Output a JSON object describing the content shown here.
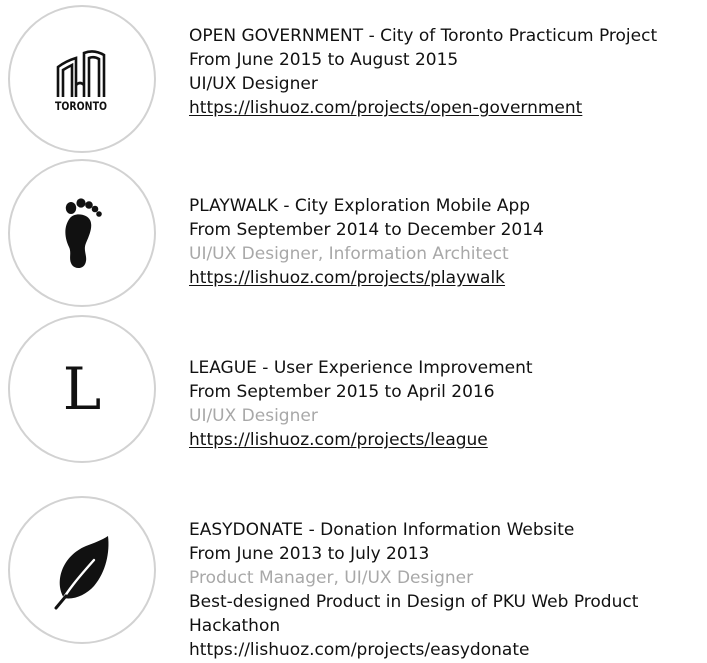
{
  "projects": [
    {
      "logo_icon": "toronto-city-hall-icon",
      "logo_text": "TORONTO",
      "title": "OPEN GOVERNMENT - City of Toronto Practicum Project",
      "dates": "From June 2015 to August 2015",
      "role": "UI/UX Designer",
      "url": "https://lishuoz.com/projects/open-government"
    },
    {
      "logo_icon": "footprint-icon",
      "title": "PLAYWALK - City Exploration Mobile App",
      "dates": "From September 2014 to December 2014",
      "role": "UI/UX Designer, Information Architect",
      "url": "https://lishuoz.com/projects/playwalk"
    },
    {
      "logo_icon": "letter-l-icon",
      "logo_letter": "L",
      "title": "LEAGUE - User Experience Improvement",
      "dates": "From September 2015 to April 2016",
      "role": "UI/UX Designer",
      "url": "https://lishuoz.com/projects/league"
    },
    {
      "logo_icon": "leaf-icon",
      "title": "EASYDONATE - Donation Information Website",
      "dates": "From June 2013 to July 2013",
      "role": "Product Manager, UI/UX Designer",
      "award": "Best-designed Product in Design of PKU Web Product Hackathon",
      "url": "https://lishuoz.com/projects/easydonate"
    }
  ],
  "colors": {
    "text": "#111111",
    "muted": "#a8a8a8",
    "circle_border": "#d2d2d2"
  }
}
